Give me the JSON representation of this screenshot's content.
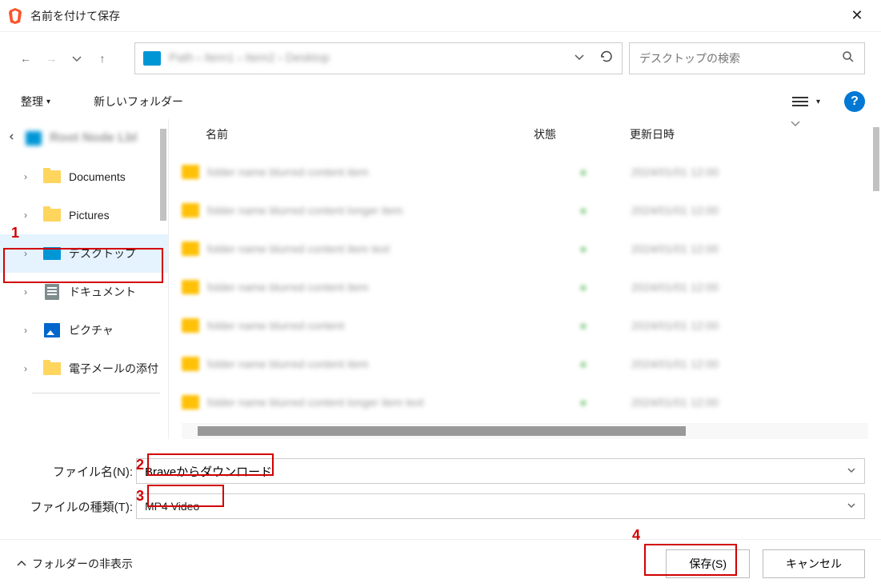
{
  "title": "名前を付けて保存",
  "nav": {
    "search_placeholder": "デスクトップの検索"
  },
  "toolbar": {
    "organize": "整理",
    "new_folder": "新しいフォルダー"
  },
  "sidebar": {
    "items": [
      {
        "label": "Documents"
      },
      {
        "label": "Pictures"
      },
      {
        "label": "デスクトップ"
      },
      {
        "label": "ドキュメント"
      },
      {
        "label": "ピクチャ"
      },
      {
        "label": "電子メールの添付"
      }
    ]
  },
  "columns": {
    "name": "名前",
    "status": "状態",
    "date": "更新日時"
  },
  "form": {
    "filename_label": "ファイル名(N):",
    "filename_value": "Braveからダウンロード",
    "filetype_label": "ファイルの種類(T):",
    "filetype_value": "MP4 Video"
  },
  "footer": {
    "hide_folders": "フォルダーの非表示",
    "save": "保存(S)",
    "cancel": "キャンセル"
  },
  "annotations": {
    "a1": "1",
    "a2": "2",
    "a3": "3",
    "a4": "4"
  }
}
